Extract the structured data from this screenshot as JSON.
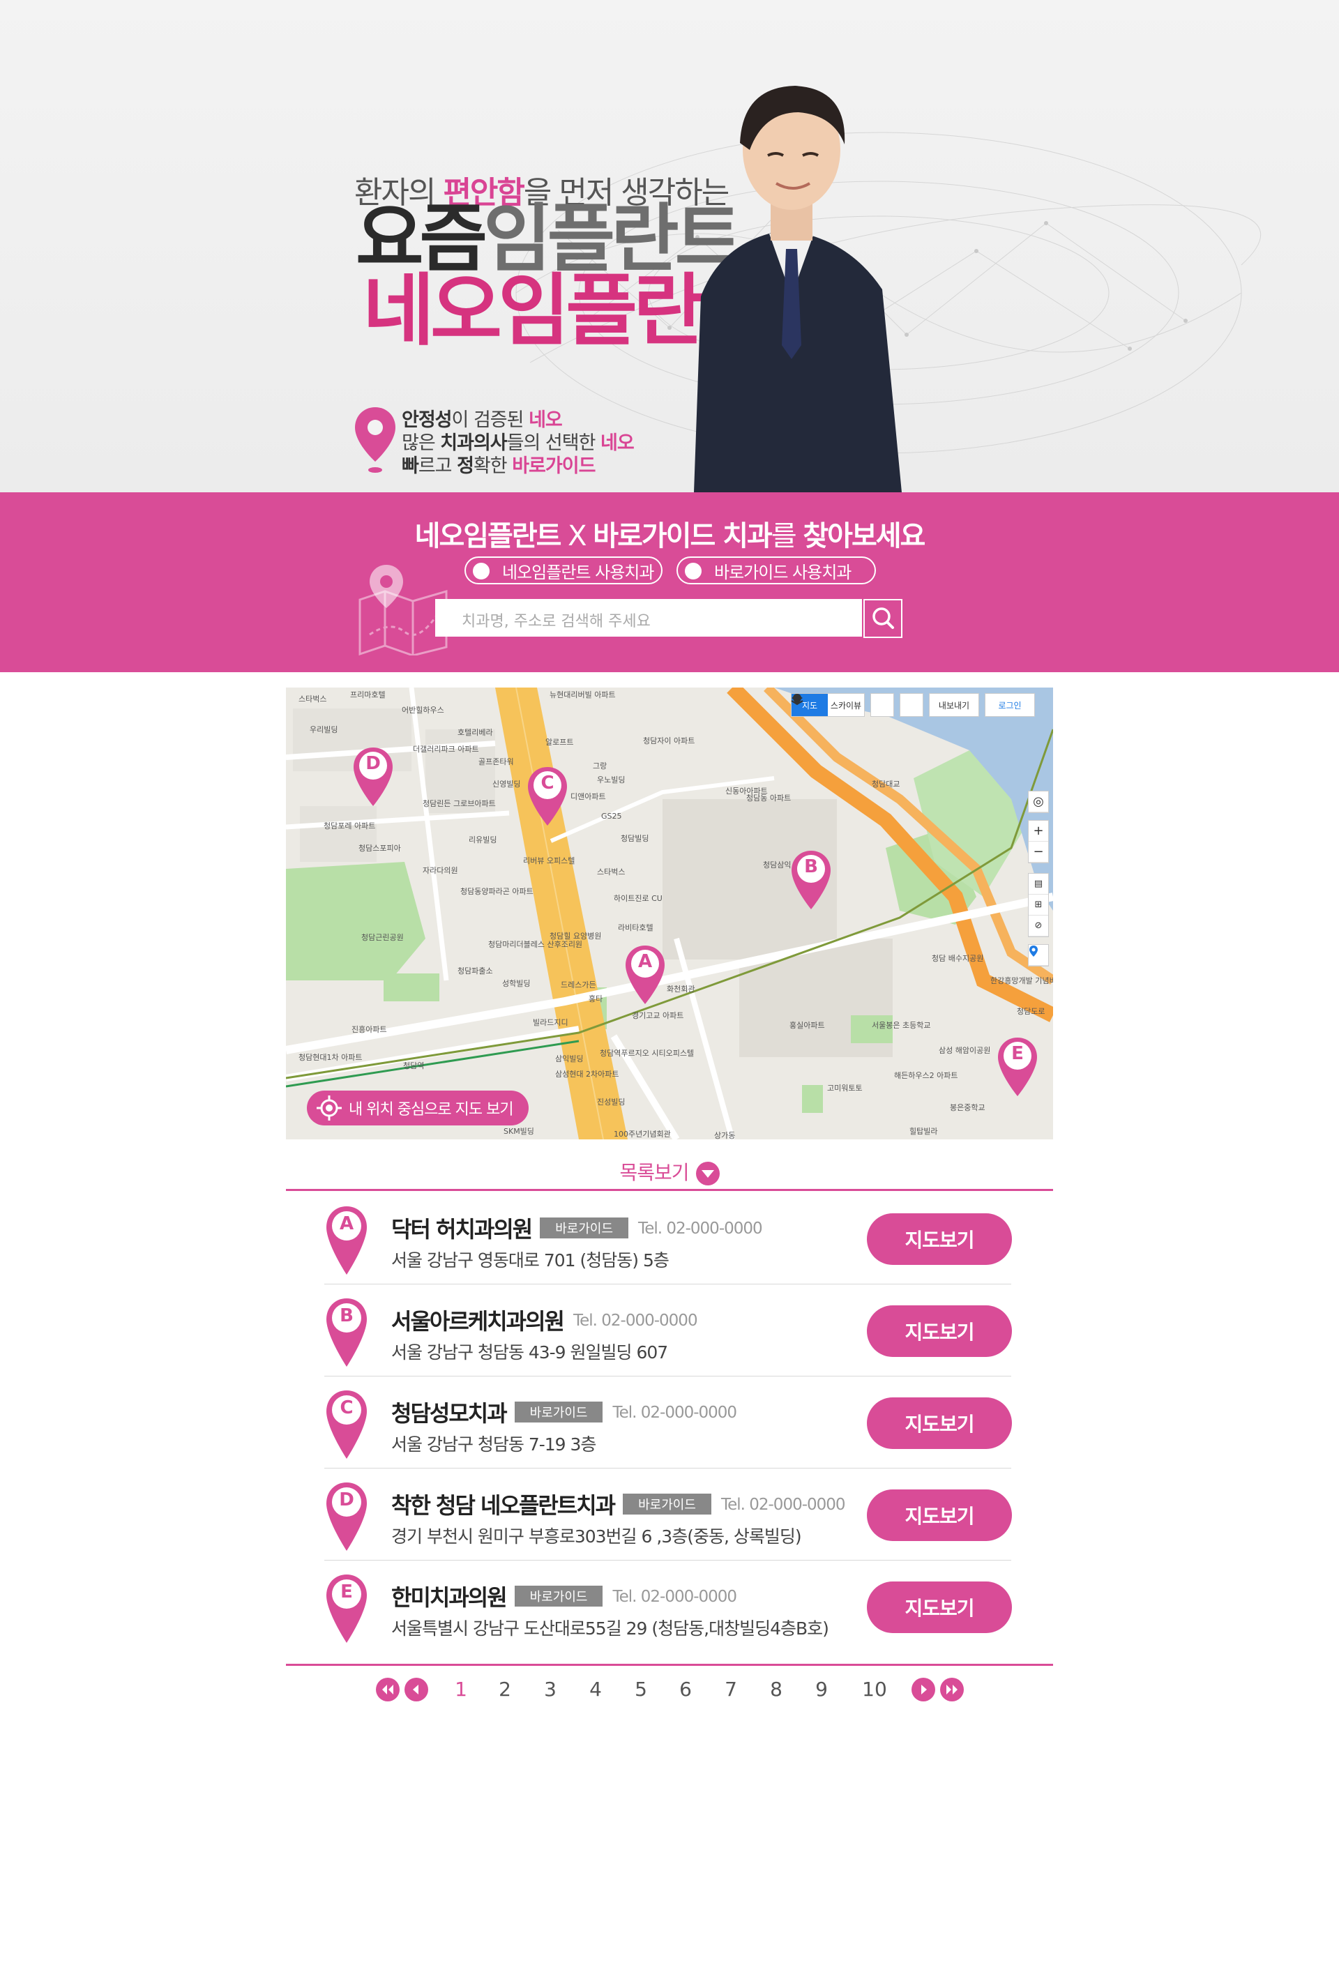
{
  "hero": {
    "tagline_pre": "환자의 ",
    "tagline_hl": "편안함",
    "tagline_post": "을 먼저 생각하는",
    "title_line1_a": "요즘",
    "title_line1_b": "임플란트",
    "title_line2": "네오임플란트",
    "lines": [
      {
        "b": "안정성",
        "t": "이 검증된 ",
        "pk": "네오"
      },
      {
        "b": "치과의사",
        "pre": "많은 ",
        "t": "들의 선택한 ",
        "pk": "네오"
      },
      {
        "b": "빠",
        "t": "르고 ",
        "b2": "정",
        "t2": "확한 ",
        "pk": "바로가이드"
      }
    ]
  },
  "search": {
    "title_a": "네오임플란트",
    "title_x": " X ",
    "title_b": "바로가이드 치과",
    "title_c": "를 ",
    "title_d": "찾아보세요",
    "radio1": "네오임플란트 사용치과",
    "radio2": "바로가이드 사용치과",
    "placeholder": "치과명, 주소로 검색해 주세요",
    "search_icon": "search-icon"
  },
  "map": {
    "tab_map": "지도",
    "tab_sky": "스카이뷰",
    "export": "내보내기",
    "login": "로그인",
    "locate_label": "내 위치 중심으로 지도 보기",
    "pins": [
      "A",
      "B",
      "C",
      "D",
      "E"
    ],
    "labels": [
      "스타벅스",
      "프리마호텔",
      "뉴현대리버빌 아파트",
      "어반힐하우스",
      "우리빌딩",
      "호텔리베라",
      "알로프트",
      "더갤러리파크 아파트",
      "골프존타워",
      "그랑",
      "청담자이 아파트",
      "신영빌딩",
      "청담린든 그로브아파트",
      "우노빌딩",
      "디앤아파트",
      "GS25",
      "신동아아파트",
      "청담포레 아파트",
      "리유빌딩",
      "청담빌딩",
      "청담스포피아",
      "자라다의원",
      "리버뷰 오피스텔",
      "스타벅스",
      "청담삼익 아파트",
      "청담동양파라곤 아파트",
      "하이트진로 CU",
      "청담근린공원",
      "라비타호텔",
      "청담마리더블레스 산후조리원",
      "청담힐 요양병원",
      "청담파출소",
      "성학빌딩",
      "드레스가든",
      "홍타",
      "화천회관",
      "빌라드지디",
      "경기고교 아파트",
      "청담동 아파트",
      "홍실아파트",
      "서울봉은 초등학교",
      "진흥아파트",
      "청담역",
      "청담현대1차 아파트",
      "삼익빌딩",
      "청담역푸르지오 시티오피스텔",
      "삼성현대 2차아파트",
      "삼성 해암이공원",
      "해든하우스2 아파트",
      "고미워토토",
      "봉은중학교",
      "진성빌딩",
      "100주년기념회관",
      "SKM빌딩",
      "상가동",
      "힐탑빌라",
      "청담 배수지공원",
      "한강흥망개발 기념비",
      "청담도로",
      "청담대교"
    ]
  },
  "list": {
    "toggle_label": "목록보기",
    "map_button": "지도보기",
    "items": [
      {
        "pin": "A",
        "name": "닥터 허치과의원",
        "badge": "바로가이드",
        "tel": "Tel. 02-000-0000",
        "addr": "서울 강남구 영동대로 701 (청담동) 5층"
      },
      {
        "pin": "B",
        "name": "서울아르케치과의원",
        "badge": "",
        "tel": "Tel. 02-000-0000",
        "addr": "서울 강남구 청담동 43-9 원일빌딩 607"
      },
      {
        "pin": "C",
        "name": "청담성모치과",
        "badge": "바로가이드",
        "tel": "Tel. 02-000-0000",
        "addr": "서울 강남구 청담동 7-19 3층"
      },
      {
        "pin": "D",
        "name": "착한 청담 네오플란트치과",
        "badge": "바로가이드",
        "tel": "Tel. 02-000-0000",
        "addr": "경기 부천시 원미구 부흥로303번길 6 ,3층(중동, 상록빌딩)"
      },
      {
        "pin": "E",
        "name": "한미치과의원",
        "badge": "바로가이드",
        "tel": "Tel. 02-000-0000",
        "addr": "서울특별시 강남구 도산대로55길 29 (청담동,대창빌딩4층B호)"
      }
    ]
  },
  "pagination": {
    "pages": [
      "1",
      "2",
      "3",
      "4",
      "5",
      "6",
      "7",
      "8",
      "9",
      "10"
    ],
    "current": "1"
  },
  "colors": {
    "accent": "#d94c97",
    "title_pink": "#d6337f",
    "badge_gray": "#888888",
    "road_yellow": "#f6c35a",
    "road_orange": "#f5a03c",
    "river": "#a9c6e3",
    "park": "#b7e0a8"
  }
}
